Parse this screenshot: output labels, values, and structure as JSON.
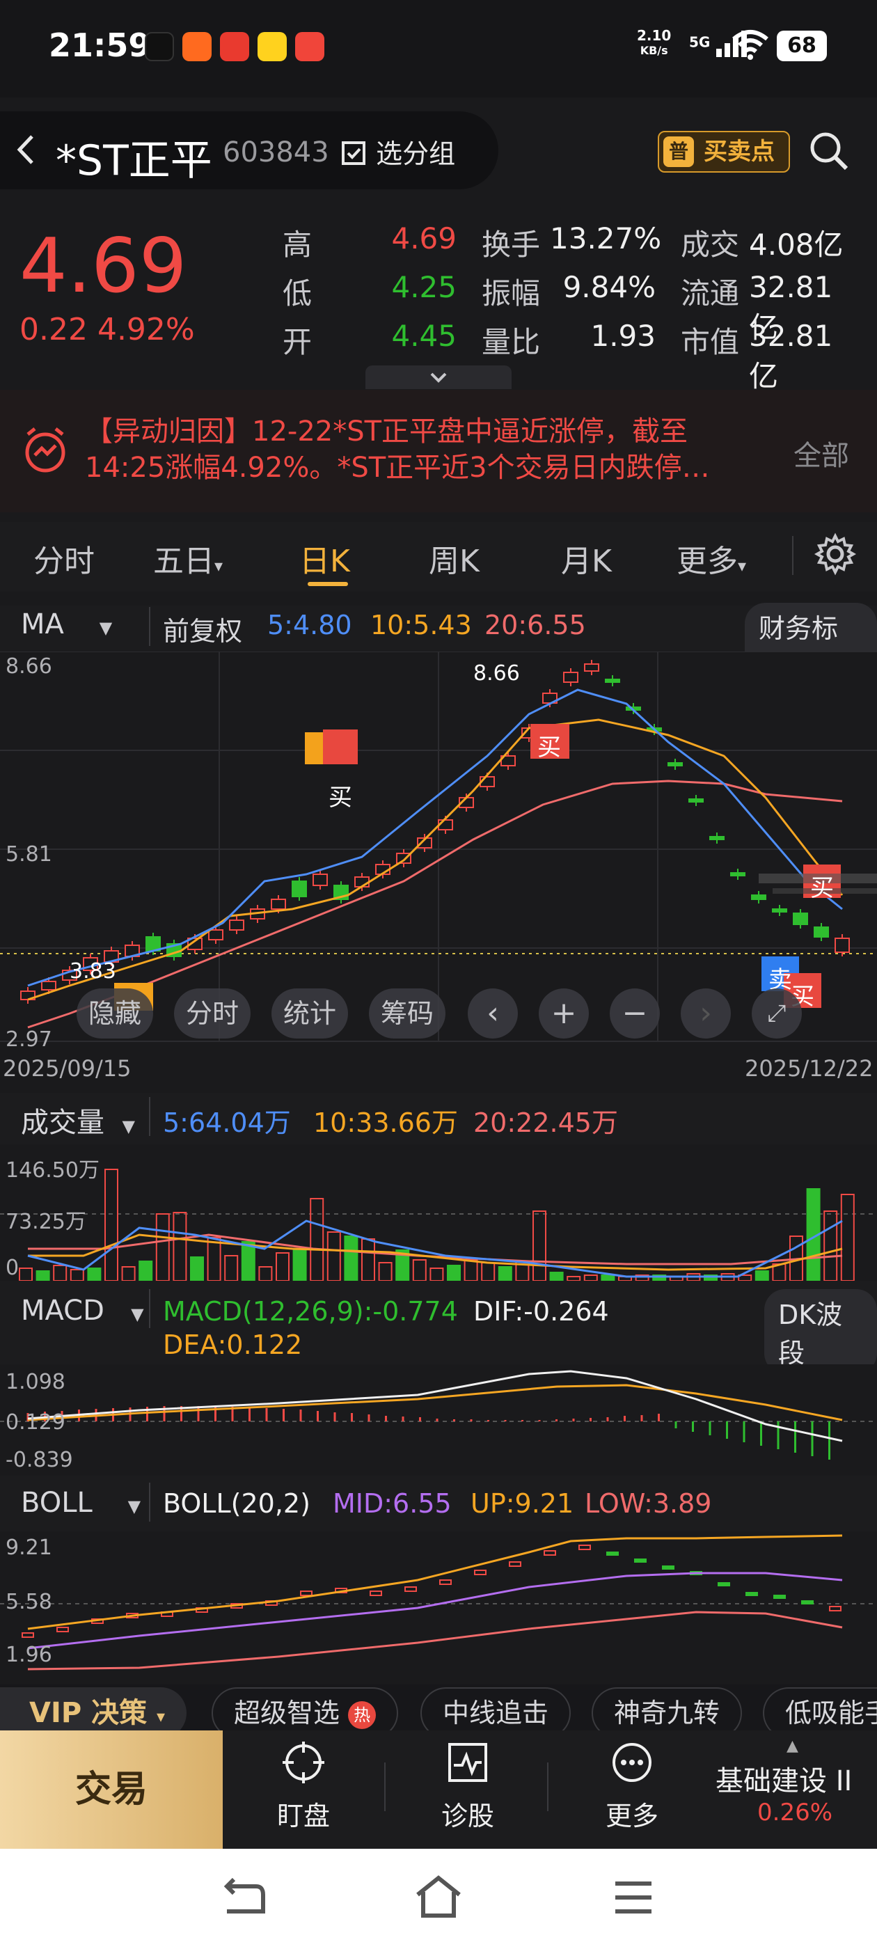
{
  "status": {
    "time": "21:59",
    "net_speed": "2.10",
    "net_unit": "KB/s",
    "network": "5G",
    "battery": "68"
  },
  "header": {
    "name": "*ST正平",
    "code": "603843",
    "group_label": "选分组",
    "bs_badge": "普",
    "bs_label": "买卖点"
  },
  "quote": {
    "price": "4.69",
    "change": "0.22 4.92%",
    "rows": [
      {
        "l1": "高",
        "v1": "4.69",
        "l2": "换手",
        "v2": "13.27%",
        "l3": "成交",
        "v3": "4.08亿"
      },
      {
        "l1": "低",
        "v1": "4.25",
        "l2": "振幅",
        "v2": "9.84%",
        "l3": "流通",
        "v3": "32.81亿"
      },
      {
        "l1": "开",
        "v1": "4.45",
        "l2": "量比",
        "v2": "1.93",
        "l3": "市值",
        "v3": "32.81亿"
      }
    ]
  },
  "news": {
    "line1": "【异动归因】12-22*ST正平盘中逼近涨停，截至",
    "line2": "14:25涨幅4.92%。*ST正平近3个交易日内跌停…",
    "all_label": "全部"
  },
  "tabs": [
    "分时",
    "五日",
    "日K",
    "周K",
    "月K",
    "更多"
  ],
  "kline": {
    "indicator": "MA",
    "adjust": "前复权",
    "ma5": "5:4.80",
    "ma10": "10:5.43",
    "ma20": "20:6.55",
    "finance_label": "财务标记",
    "y_top": "8.66",
    "y_mid": "5.81",
    "y_bot": "2.97",
    "high_mark": "8.66",
    "low_mark": "3.83",
    "date_start": "2025/09/15",
    "date_end": "2025/12/22",
    "buy_label": "买",
    "sell_label": "卖",
    "ops": [
      "隐藏",
      "分时",
      "统计",
      "筹码"
    ]
  },
  "volume": {
    "label": "成交量",
    "ma5": "5:64.04万",
    "ma10": "10:33.66万",
    "ma20": "20:22.45万",
    "y_top": "146.50万",
    "y_mid": "73.25万",
    "y_bot": "0"
  },
  "macd": {
    "label": "MACD",
    "params": "MACD(12,26,9):-0.774",
    "dif": "DIF:-0.264",
    "dea": "DEA:0.122",
    "right_label": "DK波段",
    "y_top": "1.098",
    "y_mid": "0.129",
    "y_bot": "-0.839"
  },
  "boll": {
    "label": "BOLL",
    "params": "BOLL(20,2)",
    "mid": "MID:6.55",
    "up": "UP:9.21",
    "low": "LOW:3.89",
    "y_top": "9.21",
    "y_mid": "5.58",
    "y_bot": "1.96"
  },
  "strategy": {
    "vip": "VIP 决策",
    "items": [
      "超级智选",
      "中线追击",
      "神奇九转",
      "低吸能手"
    ],
    "hot_badge": "热"
  },
  "bottom_nav": {
    "trade": "交易",
    "items": [
      "盯盘",
      "诊股",
      "更多"
    ],
    "index_name": "基础建设 II",
    "index_change": "0.26%"
  },
  "colors": {
    "up": "#f04a45",
    "down": "#2fbe2f",
    "ma5": "#4f8ef7",
    "ma10": "#f5a623",
    "ma20": "#f06b6b",
    "accent": "#f3b23c"
  }
}
